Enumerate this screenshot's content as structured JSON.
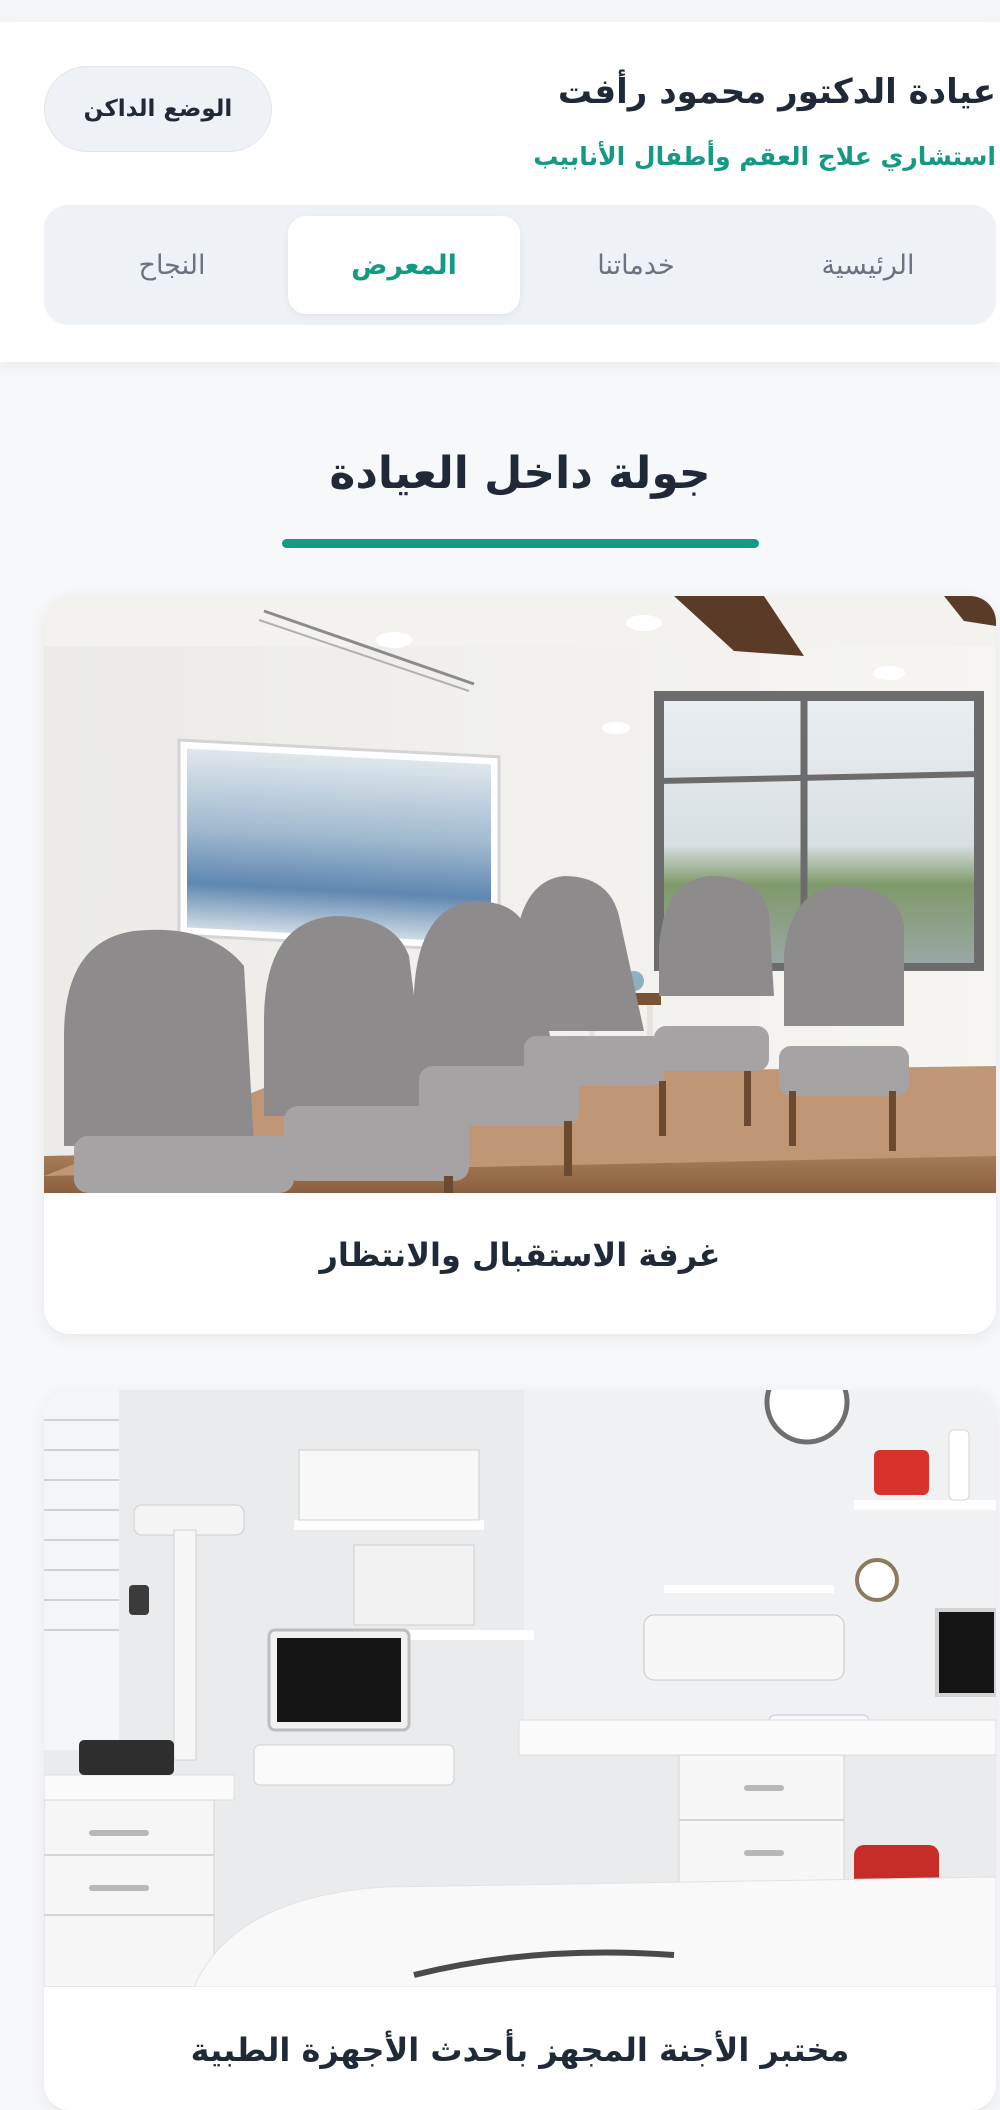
{
  "header": {
    "clinic_name": "عيادة الدكتور محمود رأفت",
    "clinic_subtitle": "استشاري علاج العقم وأطفال الأنابيب",
    "dark_mode_label": "الوضع الداكن"
  },
  "nav": {
    "tabs": [
      {
        "label": "الرئيسية",
        "active": false
      },
      {
        "label": "خدماتنا",
        "active": false
      },
      {
        "label": "المعرض",
        "active": true
      },
      {
        "label": "النجاح",
        "active": false
      }
    ]
  },
  "gallery": {
    "title": "جولة داخل العيادة",
    "items": [
      {
        "caption": "غرفة الاستقبال والانتظار",
        "image": "waiting-room-photo"
      },
      {
        "caption": "مختبر الأجنة المجهز بأحدث الأجهزة الطبية",
        "image": "embryo-lab-photo"
      }
    ]
  },
  "colors": {
    "accent": "#149a84",
    "text": "#1f2937",
    "muted": "#6b7280",
    "surface": "#eef1f5"
  }
}
